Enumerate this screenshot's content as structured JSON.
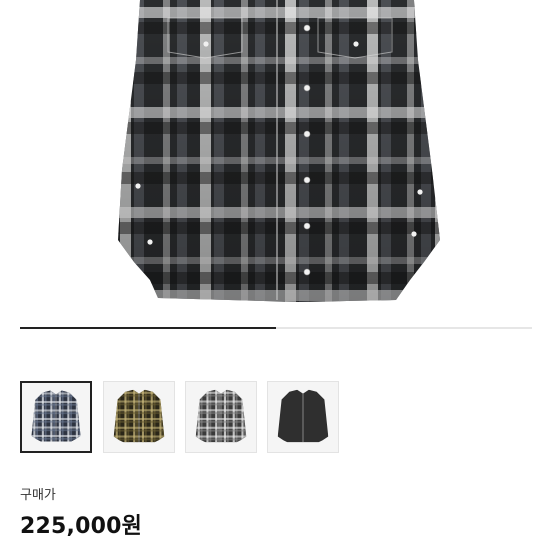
{
  "gallery": {
    "current_index": 0,
    "total_images": 2,
    "thumbnails": [
      {
        "variant": "navy-white-check",
        "selected": true
      },
      {
        "variant": "olive-black-check",
        "selected": false
      },
      {
        "variant": "grey-black-check",
        "selected": false
      },
      {
        "variant": "solid-charcoal",
        "selected": false
      }
    ]
  },
  "price": {
    "label": "구매가",
    "value": "225,000원"
  },
  "colors": {
    "progress_fill": "#222222",
    "progress_track": "#e6e6e6",
    "selected_border": "#222222"
  }
}
